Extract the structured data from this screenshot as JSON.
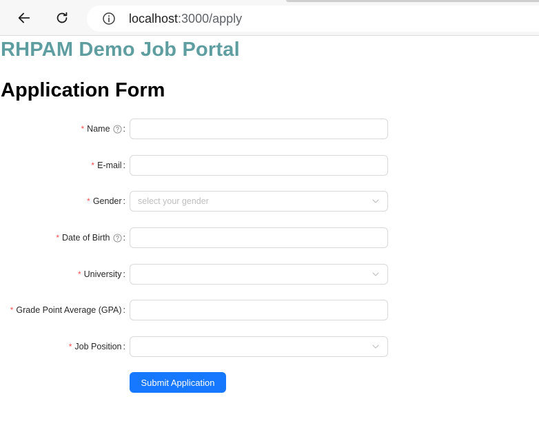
{
  "browser": {
    "url_host": "localhost",
    "url_path": ":3000/apply"
  },
  "page": {
    "site_title": "RHPAM Demo Job Portal",
    "form_title": "Application Form"
  },
  "form": {
    "required_mark": "*",
    "colon": ":",
    "fields": [
      {
        "label": "Name",
        "type": "text",
        "value": "",
        "help": true
      },
      {
        "label": "E-mail",
        "type": "text",
        "value": ""
      },
      {
        "label": "Gender",
        "type": "select",
        "value": "",
        "placeholder": "select your gender"
      },
      {
        "label": "Date of Birth",
        "type": "text",
        "value": "",
        "help": true
      },
      {
        "label": "University",
        "type": "select",
        "value": ""
      },
      {
        "label": "Grade Point Average (GPA)",
        "type": "text",
        "value": ""
      },
      {
        "label": "Job Position",
        "type": "select",
        "value": ""
      }
    ],
    "submit_label": "Submit Application"
  },
  "colors": {
    "site_title": "#5f9ea0",
    "primary_button": "#1677ff",
    "required": "#ff4d4f"
  },
  "icons": {
    "back": "arrow-left-icon",
    "reload": "reload-icon",
    "site_info": "info-icon",
    "help": "question-circle-icon",
    "select": "chevron-down-icon"
  }
}
